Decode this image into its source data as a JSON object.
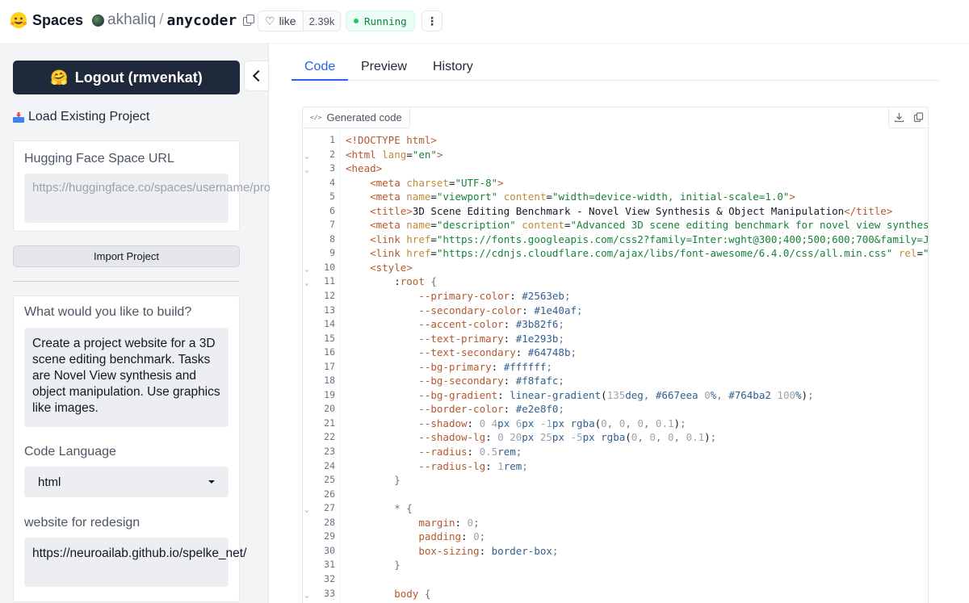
{
  "header": {
    "brand": "Spaces",
    "owner": "akhaliq",
    "repo": "anycoder",
    "like_label": "like",
    "like_count": "2.39k",
    "status": "Running"
  },
  "sidebar": {
    "logout_label": "Logout (rmvenkat)",
    "load_project_label": "Load Existing Project",
    "space_url_label": "Hugging Face Space URL",
    "space_url_placeholder": "https://huggingface.co/spaces/username/project",
    "import_button": "Import Project",
    "build_label": "What would you like to build?",
    "build_value": "Create a project website for a 3D scene editing benchmark. Tasks are Novel View synthesis and object manipulation. Use graphics like images.",
    "code_language_label": "Code Language",
    "code_language_value": "html",
    "redesign_label": "website for redesign",
    "redesign_value": "https://neuroailab.github.io/spelke_net/"
  },
  "main": {
    "tabs": [
      "Code",
      "Preview",
      "History"
    ],
    "active_tab": "Code",
    "code_tag": "Generated code",
    "code_lines": [
      {
        "n": "1",
        "fold": false,
        "parts": [
          [
            "tag",
            "<!DOCTYPE html>"
          ]
        ]
      },
      {
        "n": "2",
        "fold": true,
        "parts": [
          [
            "tag",
            "<html "
          ],
          [
            "attr",
            "lang"
          ],
          [
            "plain",
            "="
          ],
          [
            "str",
            "\"en\""
          ],
          [
            "tag",
            ">"
          ]
        ]
      },
      {
        "n": "3",
        "fold": true,
        "parts": [
          [
            "tag",
            "<head>"
          ]
        ]
      },
      {
        "n": "4",
        "fold": false,
        "parts": [
          [
            "plain",
            "    "
          ],
          [
            "tag",
            "<meta "
          ],
          [
            "attr",
            "charset"
          ],
          [
            "plain",
            "="
          ],
          [
            "str",
            "\"UTF-8\""
          ],
          [
            "tag",
            ">"
          ]
        ]
      },
      {
        "n": "5",
        "fold": false,
        "parts": [
          [
            "plain",
            "    "
          ],
          [
            "tag",
            "<meta "
          ],
          [
            "attr",
            "name"
          ],
          [
            "plain",
            "="
          ],
          [
            "str",
            "\"viewport\""
          ],
          [
            "plain",
            " "
          ],
          [
            "attr",
            "content"
          ],
          [
            "plain",
            "="
          ],
          [
            "str",
            "\"width=device-width, initial-scale=1.0\""
          ],
          [
            "tag",
            ">"
          ]
        ]
      },
      {
        "n": "6",
        "fold": false,
        "parts": [
          [
            "plain",
            "    "
          ],
          [
            "tag",
            "<title>"
          ],
          [
            "plain",
            "3D Scene Editing Benchmark - Novel View Synthesis & Object Manipulation"
          ],
          [
            "tag",
            "</title>"
          ]
        ]
      },
      {
        "n": "7",
        "fold": false,
        "parts": [
          [
            "plain",
            "    "
          ],
          [
            "tag",
            "<meta "
          ],
          [
            "attr",
            "name"
          ],
          [
            "plain",
            "="
          ],
          [
            "str",
            "\"description\""
          ],
          [
            "plain",
            " "
          ],
          [
            "attr",
            "content"
          ],
          [
            "plain",
            "="
          ],
          [
            "str",
            "\"Advanced 3D scene editing benchmark for novel view synthes"
          ]
        ]
      },
      {
        "n": "8",
        "fold": false,
        "parts": [
          [
            "plain",
            "    "
          ],
          [
            "tag",
            "<link "
          ],
          [
            "attr",
            "href"
          ],
          [
            "plain",
            "="
          ],
          [
            "str",
            "\"https://fonts.googleapis.com/css2?family=Inter:wght@300;400;500;600;700&family=J"
          ]
        ]
      },
      {
        "n": "9",
        "fold": false,
        "parts": [
          [
            "plain",
            "    "
          ],
          [
            "tag",
            "<link "
          ],
          [
            "attr",
            "href"
          ],
          [
            "plain",
            "="
          ],
          [
            "str",
            "\"https://cdnjs.cloudflare.com/ajax/libs/font-awesome/6.4.0/css/all.min.css\""
          ],
          [
            "plain",
            " "
          ],
          [
            "attr",
            "rel"
          ],
          [
            "plain",
            "="
          ],
          [
            "str",
            "\""
          ]
        ]
      },
      {
        "n": "10",
        "fold": true,
        "parts": [
          [
            "plain",
            "    "
          ],
          [
            "tag",
            "<style>"
          ]
        ]
      },
      {
        "n": "11",
        "fold": true,
        "parts": [
          [
            "plain",
            "        "
          ],
          [
            "plain",
            ":"
          ],
          [
            "prop",
            "root"
          ],
          [
            "plain",
            " "
          ],
          [
            "brace",
            "{"
          ]
        ]
      },
      {
        "n": "12",
        "fold": false,
        "parts": [
          [
            "plain",
            "            "
          ],
          [
            "prop",
            "--primary-color"
          ],
          [
            "plain",
            ": "
          ],
          [
            "val",
            "#2563eb"
          ],
          [
            "brace",
            ";"
          ]
        ]
      },
      {
        "n": "13",
        "fold": false,
        "parts": [
          [
            "plain",
            "            "
          ],
          [
            "prop",
            "--secondary-color"
          ],
          [
            "plain",
            ": "
          ],
          [
            "val",
            "#1e40af"
          ],
          [
            "brace",
            ";"
          ]
        ]
      },
      {
        "n": "14",
        "fold": false,
        "parts": [
          [
            "plain",
            "            "
          ],
          [
            "prop",
            "--accent-color"
          ],
          [
            "plain",
            ": "
          ],
          [
            "val",
            "#3b82f6"
          ],
          [
            "brace",
            ";"
          ]
        ]
      },
      {
        "n": "15",
        "fold": false,
        "parts": [
          [
            "plain",
            "            "
          ],
          [
            "prop",
            "--text-primary"
          ],
          [
            "plain",
            ": "
          ],
          [
            "val",
            "#1e293b"
          ],
          [
            "brace",
            ";"
          ]
        ]
      },
      {
        "n": "16",
        "fold": false,
        "parts": [
          [
            "plain",
            "            "
          ],
          [
            "prop",
            "--text-secondary"
          ],
          [
            "plain",
            ": "
          ],
          [
            "val",
            "#64748b"
          ],
          [
            "brace",
            ";"
          ]
        ]
      },
      {
        "n": "17",
        "fold": false,
        "parts": [
          [
            "plain",
            "            "
          ],
          [
            "prop",
            "--bg-primary"
          ],
          [
            "plain",
            ": "
          ],
          [
            "val",
            "#ffffff"
          ],
          [
            "brace",
            ";"
          ]
        ]
      },
      {
        "n": "18",
        "fold": false,
        "parts": [
          [
            "plain",
            "            "
          ],
          [
            "prop",
            "--bg-secondary"
          ],
          [
            "plain",
            ": "
          ],
          [
            "val",
            "#f8fafc"
          ],
          [
            "brace",
            ";"
          ]
        ]
      },
      {
        "n": "19",
        "fold": false,
        "parts": [
          [
            "plain",
            "            "
          ],
          [
            "prop",
            "--bg-gradient"
          ],
          [
            "plain",
            ": "
          ],
          [
            "val",
            "linear-gradient"
          ],
          [
            "plain",
            "("
          ],
          [
            "num",
            "135"
          ],
          [
            "val",
            "deg"
          ],
          [
            "brace",
            ", "
          ],
          [
            "val",
            "#667eea "
          ],
          [
            "num",
            "0"
          ],
          [
            "val",
            "%"
          ],
          [
            "brace",
            ", "
          ],
          [
            "val",
            "#764ba2 "
          ],
          [
            "num",
            "100"
          ],
          [
            "val",
            "%"
          ],
          [
            "plain",
            ")"
          ],
          [
            "brace",
            ";"
          ]
        ]
      },
      {
        "n": "20",
        "fold": false,
        "parts": [
          [
            "plain",
            "            "
          ],
          [
            "prop",
            "--border-color"
          ],
          [
            "plain",
            ": "
          ],
          [
            "val",
            "#e2e8f0"
          ],
          [
            "brace",
            ";"
          ]
        ]
      },
      {
        "n": "21",
        "fold": false,
        "parts": [
          [
            "plain",
            "            "
          ],
          [
            "prop",
            "--shadow"
          ],
          [
            "plain",
            ": "
          ],
          [
            "num",
            "0 4"
          ],
          [
            "val",
            "px "
          ],
          [
            "num",
            "6"
          ],
          [
            "val",
            "px "
          ],
          [
            "num",
            "-1"
          ],
          [
            "val",
            "px rgba"
          ],
          [
            "plain",
            "("
          ],
          [
            "num",
            "0"
          ],
          [
            "brace",
            ", "
          ],
          [
            "num",
            "0"
          ],
          [
            "brace",
            ", "
          ],
          [
            "num",
            "0"
          ],
          [
            "brace",
            ", "
          ],
          [
            "num",
            "0.1"
          ],
          [
            "plain",
            ")"
          ],
          [
            "brace",
            ";"
          ]
        ]
      },
      {
        "n": "22",
        "fold": false,
        "parts": [
          [
            "plain",
            "            "
          ],
          [
            "prop",
            "--shadow-lg"
          ],
          [
            "plain",
            ": "
          ],
          [
            "num",
            "0 20"
          ],
          [
            "val",
            "px "
          ],
          [
            "num",
            "25"
          ],
          [
            "val",
            "px "
          ],
          [
            "num",
            "-5"
          ],
          [
            "val",
            "px rgba"
          ],
          [
            "plain",
            "("
          ],
          [
            "num",
            "0"
          ],
          [
            "brace",
            ", "
          ],
          [
            "num",
            "0"
          ],
          [
            "brace",
            ", "
          ],
          [
            "num",
            "0"
          ],
          [
            "brace",
            ", "
          ],
          [
            "num",
            "0.1"
          ],
          [
            "plain",
            ")"
          ],
          [
            "brace",
            ";"
          ]
        ]
      },
      {
        "n": "23",
        "fold": false,
        "parts": [
          [
            "plain",
            "            "
          ],
          [
            "prop",
            "--radius"
          ],
          [
            "plain",
            ": "
          ],
          [
            "num",
            "0.5"
          ],
          [
            "val",
            "rem"
          ],
          [
            "brace",
            ";"
          ]
        ]
      },
      {
        "n": "24",
        "fold": false,
        "parts": [
          [
            "plain",
            "            "
          ],
          [
            "prop",
            "--radius-lg"
          ],
          [
            "plain",
            ": "
          ],
          [
            "num",
            "1"
          ],
          [
            "val",
            "rem"
          ],
          [
            "brace",
            ";"
          ]
        ]
      },
      {
        "n": "25",
        "fold": false,
        "parts": [
          [
            "plain",
            "        "
          ],
          [
            "brace",
            "}"
          ]
        ]
      },
      {
        "n": "26",
        "fold": false,
        "parts": [
          [
            "plain",
            ""
          ]
        ]
      },
      {
        "n": "27",
        "fold": true,
        "parts": [
          [
            "plain",
            "        "
          ],
          [
            "brace",
            "* {"
          ]
        ]
      },
      {
        "n": "28",
        "fold": false,
        "parts": [
          [
            "plain",
            "            "
          ],
          [
            "prop",
            "margin"
          ],
          [
            "plain",
            ": "
          ],
          [
            "num",
            "0"
          ],
          [
            "brace",
            ";"
          ]
        ]
      },
      {
        "n": "29",
        "fold": false,
        "parts": [
          [
            "plain",
            "            "
          ],
          [
            "prop",
            "padding"
          ],
          [
            "plain",
            ": "
          ],
          [
            "num",
            "0"
          ],
          [
            "brace",
            ";"
          ]
        ]
      },
      {
        "n": "30",
        "fold": false,
        "parts": [
          [
            "plain",
            "            "
          ],
          [
            "prop",
            "box-sizing"
          ],
          [
            "plain",
            ": "
          ],
          [
            "val",
            "border-box"
          ],
          [
            "brace",
            ";"
          ]
        ]
      },
      {
        "n": "31",
        "fold": false,
        "parts": [
          [
            "plain",
            "        "
          ],
          [
            "brace",
            "}"
          ]
        ]
      },
      {
        "n": "32",
        "fold": false,
        "parts": [
          [
            "plain",
            ""
          ]
        ]
      },
      {
        "n": "33",
        "fold": true,
        "parts": [
          [
            "plain",
            "        "
          ],
          [
            "prop",
            "body"
          ],
          [
            "plain",
            " "
          ],
          [
            "brace",
            "{"
          ]
        ]
      }
    ]
  },
  "colors": {
    "accent": "#2563eb",
    "logout_bg": "#1e293b",
    "running_text": "#15803d"
  },
  "icons": {
    "brand": "hugging-face-icon",
    "copy": "copy-icon",
    "like": "heart-icon",
    "more": "kebab-icon",
    "collapse": "chevron-left-icon",
    "load": "inbox-tray-icon",
    "code_tag": "code-icon",
    "download": "download-icon",
    "copy_code": "copy-icon"
  }
}
